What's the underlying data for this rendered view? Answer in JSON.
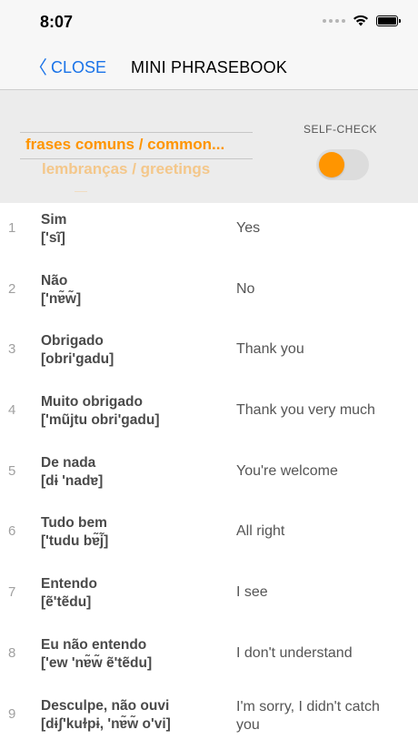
{
  "status": {
    "time": "8:07"
  },
  "nav": {
    "close_label": "CLOSE",
    "close_chevron": "〈",
    "title": "MINI PHRASEBOOK"
  },
  "picker": {
    "selected": "frases comuns / common...",
    "next": "lembranças / greetings",
    "next2": "—"
  },
  "self_check": {
    "label": "SELF-CHECK",
    "on": true
  },
  "colors": {
    "accent": "#ff9500",
    "link": "#1a73e8"
  },
  "phrases": [
    {
      "num": "1",
      "pt": "Sim",
      "ipa": "['sĩ]",
      "en": "Yes"
    },
    {
      "num": "2",
      "pt": "Não",
      "ipa": "['nɐ̃w̃]",
      "en": "No"
    },
    {
      "num": "3",
      "pt": "Obrigado",
      "ipa": "[obri'gadu]",
      "en": "Thank you"
    },
    {
      "num": "4",
      "pt": "Muito obrigado",
      "ipa": "['mũjtu obri'gadu]",
      "en": "Thank you very much"
    },
    {
      "num": "5",
      "pt": "De nada",
      "ipa": "[dɨ 'nadɐ]",
      "en": "You're welcome"
    },
    {
      "num": "6",
      "pt": "Tudo bem",
      "ipa": "['tudu bɐ̃j̃]",
      "en": "All right"
    },
    {
      "num": "7",
      "pt": "Entendo",
      "ipa": "[ẽ'tẽdu]",
      "en": "I see"
    },
    {
      "num": "8",
      "pt": "Eu não entendo",
      "ipa": "['ew 'nɐ̃w̃ ẽ'tẽdu]",
      "en": "I don't understand"
    },
    {
      "num": "9",
      "pt": "Desculpe, não ouvi",
      "ipa": "[dɨʃ'kuɫpɨ, 'nɐ̃w̃ o'vi]",
      "en": "I'm sorry, I didn't catch you"
    }
  ]
}
